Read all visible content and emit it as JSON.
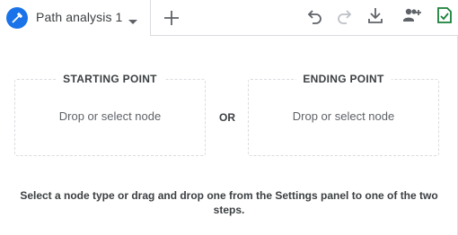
{
  "tab": {
    "title": "Path analysis 1",
    "icon": "path-analysis-icon",
    "accent": "#1a73e8"
  },
  "toolbar": {
    "icons": [
      "undo-icon",
      "redo-icon",
      "download-icon",
      "share-users-icon",
      "saved-check-icon"
    ],
    "saved_color": "#188038"
  },
  "steps": {
    "start": {
      "title": "STARTING POINT",
      "placeholder": "Drop or select node"
    },
    "end": {
      "title": "ENDING POINT",
      "placeholder": "Drop or select node"
    },
    "or": "OR"
  },
  "instructions": "Select a node type or drag and drop one from the Settings panel to one of the two steps."
}
